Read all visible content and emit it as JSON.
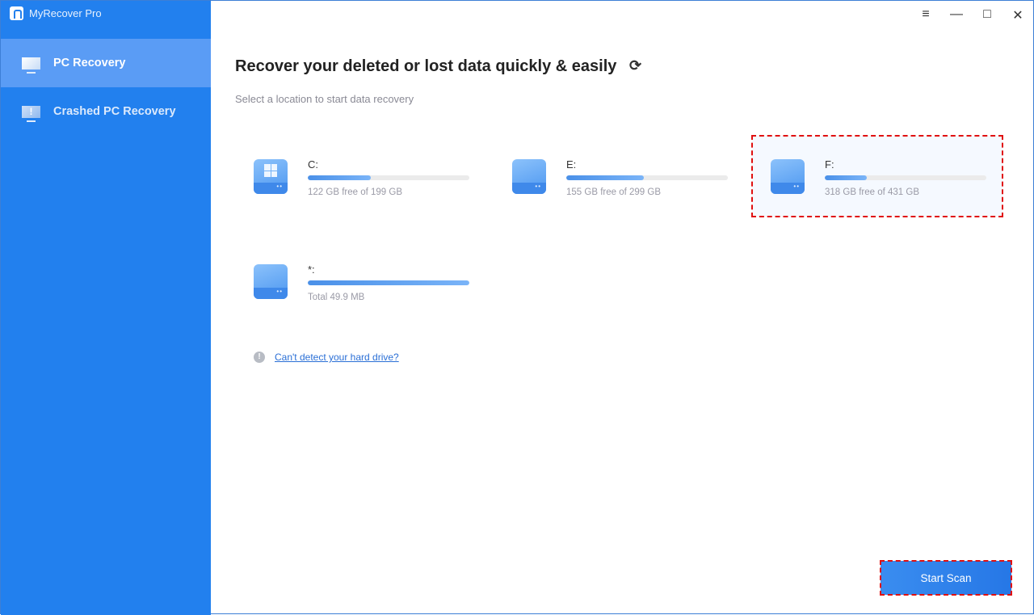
{
  "app": {
    "title": "MyRecover Pro"
  },
  "sidebar": {
    "items": [
      {
        "label": "PC Recovery",
        "icon": "monitor-icon",
        "active": true
      },
      {
        "label": "Crashed PC Recovery",
        "icon": "monitor-warning-icon",
        "active": false
      }
    ]
  },
  "window_controls": {
    "menu": "≡",
    "minimize": "—",
    "maximize": "□",
    "close": "✕"
  },
  "main": {
    "title": "Recover your deleted or lost data quickly & easily",
    "refresh_icon": "⟳",
    "subtitle": "Select a location to start data recovery",
    "drives": [
      {
        "name": "C:",
        "info": "122 GB free of 199 GB",
        "used_fraction": 0.39,
        "icon": "windows-drive-icon",
        "selected": false
      },
      {
        "name": "E:",
        "info": "155 GB free of 299 GB",
        "used_fraction": 0.48,
        "icon": "drive-icon",
        "selected": false
      },
      {
        "name": "F:",
        "info": "318 GB free of 431 GB",
        "used_fraction": 0.26,
        "icon": "drive-icon",
        "selected": true
      },
      {
        "name": "*:",
        "info": "Total 49.9 MB",
        "used_fraction": 1.0,
        "icon": "drive-icon",
        "selected": false
      }
    ],
    "help_icon": "!",
    "help_link": "Can't detect your hard drive?",
    "start_scan": "Start Scan"
  },
  "colors": {
    "sidebar": "#2280ee",
    "sidebar_active": "#5a9cf5",
    "link": "#2a6fd6",
    "selection_outline": "#e01010"
  }
}
